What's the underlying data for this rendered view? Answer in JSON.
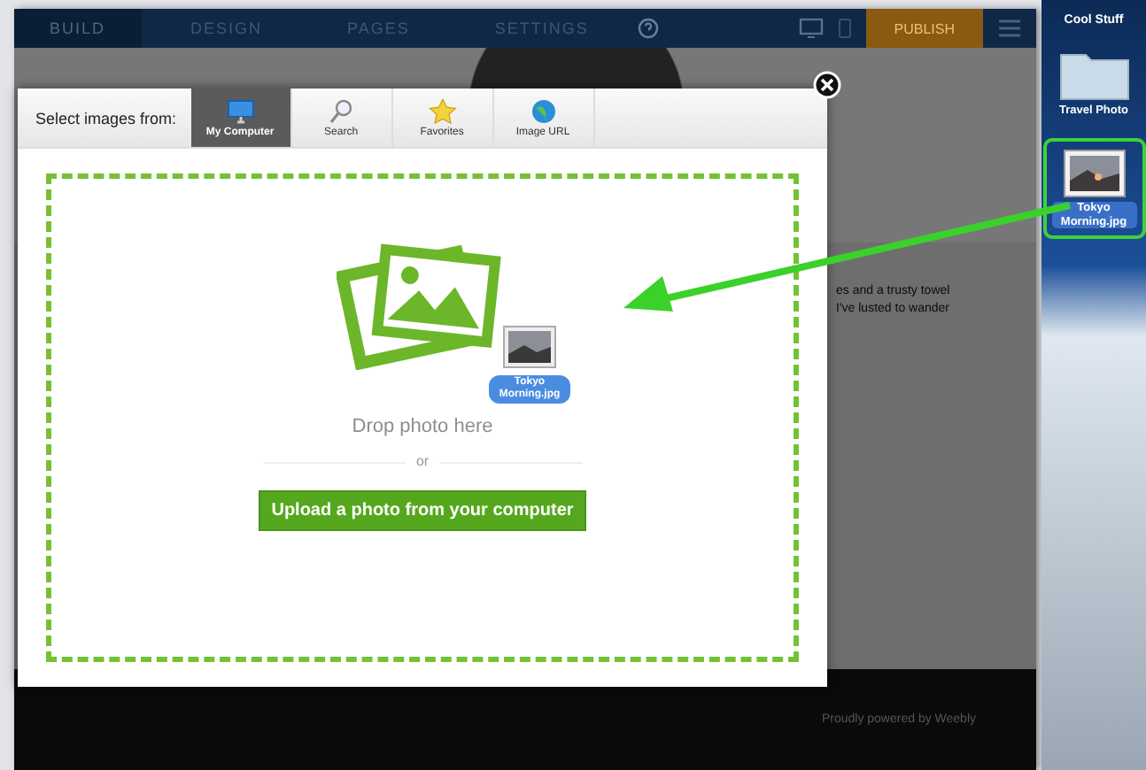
{
  "top_bar": {
    "tabs": [
      {
        "label": "BUILD",
        "selected": true
      },
      {
        "label": "DESIGN",
        "selected": false
      },
      {
        "label": "PAGES",
        "selected": false
      },
      {
        "label": "SETTINGS",
        "selected": false
      }
    ],
    "publish": "PUBLISH"
  },
  "page_text": [
    "es and a trusty towel",
    "I've lusted to wander"
  ],
  "footer": "Proudly powered by Weebly",
  "dialog": {
    "prompt": "Select images from:",
    "tabs": [
      {
        "label": "My Computer",
        "selected": true,
        "kind": "computer"
      },
      {
        "label": "Search",
        "selected": false,
        "kind": "search"
      },
      {
        "label": "Favorites",
        "selected": false,
        "kind": "favorites"
      },
      {
        "label": "Image URL",
        "selected": false,
        "kind": "url"
      }
    ],
    "drop_text": "Drop photo here",
    "separator": "or",
    "upload_button": "Upload a photo from your computer",
    "dragged_file": "Tokyo Morning.jpg"
  },
  "desktop": {
    "title": "Cool Stuff",
    "items": [
      {
        "label": "Travel Photo",
        "kind": "folder",
        "selected": false
      },
      {
        "label": "Tokyo Morning.jpg",
        "kind": "image",
        "selected": true
      }
    ]
  }
}
